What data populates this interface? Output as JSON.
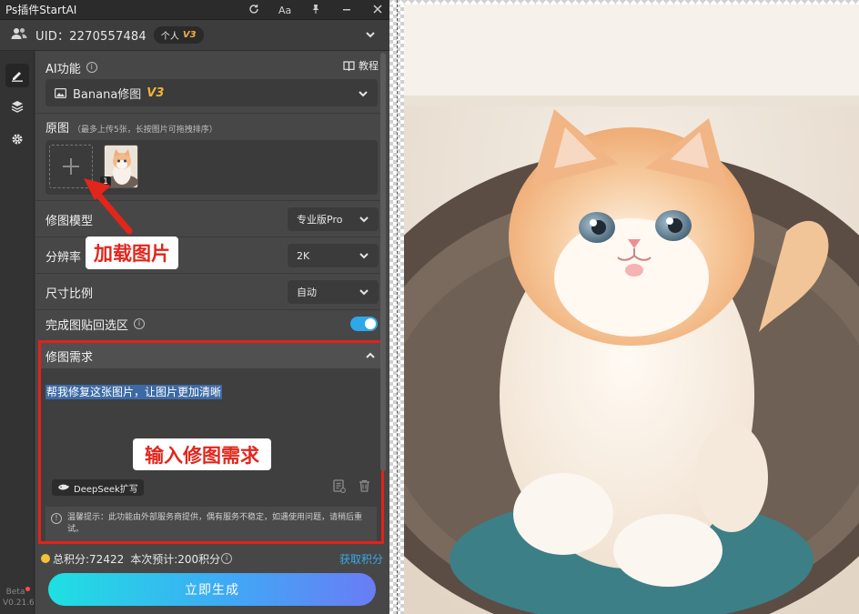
{
  "titlebar": {
    "title": "Ps插件StartAI",
    "icons": [
      "refresh-icon",
      "font-size-icon",
      "pin-icon",
      "minimize-icon",
      "close-icon"
    ],
    "font_label": "Aa"
  },
  "user": {
    "uid_label": "UID：2270557484",
    "plan": "个人",
    "plan_version": "V3"
  },
  "sidebar": {
    "items": [
      "edit-icon",
      "layers-icon",
      "settings-icon"
    ],
    "beta": "Beta",
    "version": "V0.21.6"
  },
  "ai": {
    "label": "AI功能",
    "tutorial": "教程",
    "function_name": "Banana修图",
    "function_version": "V3"
  },
  "original": {
    "label": "原图",
    "hint": "（最多上传5张，长按图片可拖拽排序）",
    "thumb_index": "1"
  },
  "options": {
    "model_label": "修图模型",
    "model_value": "专业版Pro",
    "resolution_label": "分辨率",
    "resolution_value": "2K",
    "ratio_label": "尺寸比例",
    "ratio_value": "自动",
    "paste_label": "完成图贴回选区",
    "paste_enabled": true
  },
  "requirement": {
    "label": "修图需求",
    "text": "帮我修复这张图片，让图片更加清晰",
    "deepseek_label": "DeepSeek扩写",
    "notice": "温馨提示：此功能由外部服务商提供，偶有服务不稳定，如遇使用问题，请稍后重试。"
  },
  "points": {
    "total": "总积分:72422",
    "estimate": "本次预计:200积分",
    "get_points": "获取积分"
  },
  "generate_label": "立即生成",
  "annotations": {
    "load_image": "加载图片",
    "input_requirement": "输入修图需求"
  },
  "colors": {
    "accent_blue": "#3aa8e6",
    "highlight_red": "#e0221b",
    "version_gold": "#f0b23b"
  }
}
